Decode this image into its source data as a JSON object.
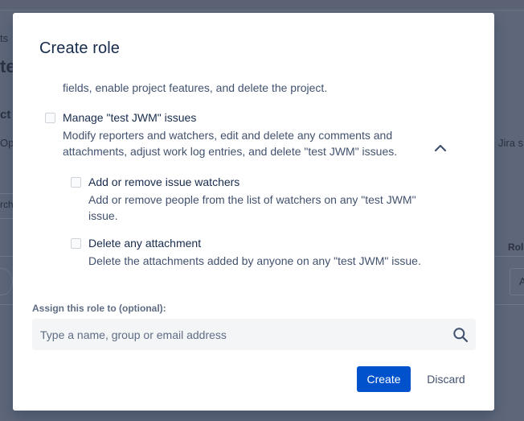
{
  "background": {
    "fragments": [
      "ts",
      "te",
      "ct",
      "Ope",
      "Jira s",
      "rch",
      "Rol",
      "A"
    ]
  },
  "modal": {
    "title": "Create role",
    "permissions": {
      "previous_desc_tail": "fields, enable project features, and delete the project.",
      "group": {
        "title": "Manage \"test JWM\" issues",
        "desc_line1": "Modify reporters and watchers, edit and delete any comments and",
        "desc_line2": "attachments, adjust work log entries, and delete \"test JWM\" issues.",
        "expanded_icon": "chevron-up-icon",
        "children": [
          {
            "title": "Add or remove issue watchers",
            "desc_line1": "Add or remove people from the list of watchers on any \"test JWM\"",
            "desc_line2": "issue."
          },
          {
            "title": "Delete any attachment",
            "desc_line1": "Delete the attachments added by anyone on any \"test JWM\" issue."
          }
        ]
      }
    },
    "assign": {
      "label": "Assign this role to (optional):",
      "placeholder": "Type a name, group or email address",
      "icon": "search-icon"
    },
    "buttons": {
      "create": "Create",
      "discard": "Discard"
    },
    "colors": {
      "primary": "#0052cc",
      "text": "#172b4d",
      "subtext": "#42526e",
      "overlay": "#5e6679"
    }
  }
}
